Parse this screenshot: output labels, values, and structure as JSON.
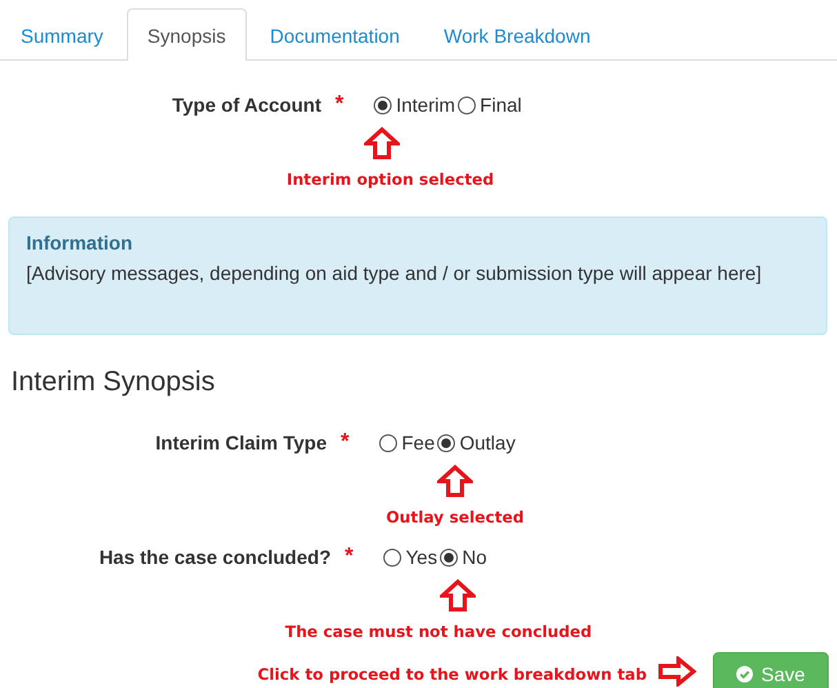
{
  "tabs": [
    {
      "label": "Summary",
      "selected": false
    },
    {
      "label": "Synopsis",
      "selected": true
    },
    {
      "label": "Documentation",
      "selected": false
    },
    {
      "label": "Work Breakdown",
      "selected": false
    }
  ],
  "account_field": {
    "label": "Type of Account",
    "required_mark": "*",
    "options": [
      {
        "label": "Interim",
        "selected": true
      },
      {
        "label": "Final",
        "selected": false
      }
    ],
    "annotation": "Interim option selected"
  },
  "info_panel": {
    "title": "Information",
    "message": "[Advisory messages, depending on aid type and / or submission type will appear here]"
  },
  "section_title": "Interim Synopsis",
  "fields": [
    {
      "label": "Interim Claim Type",
      "required_mark": "*",
      "options": [
        {
          "label": "Fee",
          "selected": false
        },
        {
          "label": "Outlay",
          "selected": true
        }
      ],
      "annotation": "Outlay selected"
    },
    {
      "label": "Has the case concluded?",
      "required_mark": "*",
      "options": [
        {
          "label": "Yes",
          "selected": false
        },
        {
          "label": "No",
          "selected": true
        }
      ],
      "annotation": "The case must not have concluded"
    }
  ],
  "footer": {
    "annotation": "Click to proceed to the work breakdown tab",
    "save_button": "Save"
  }
}
